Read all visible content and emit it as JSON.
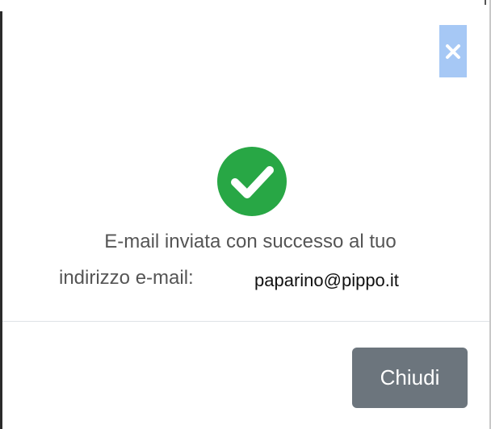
{
  "modal": {
    "close_label": "×",
    "success_icon": "check-circle-icon",
    "message_line1": "E-mail inviata con successo al tuo",
    "message_line2": "indirizzo e-mail:",
    "email": "paparino@pippo.it",
    "close_button_label": "Chiudi"
  },
  "colors": {
    "success": "#28a745",
    "close_button_bg": "#6c757d",
    "close_x_highlight": "#a6c8f5",
    "text": "#555555"
  }
}
